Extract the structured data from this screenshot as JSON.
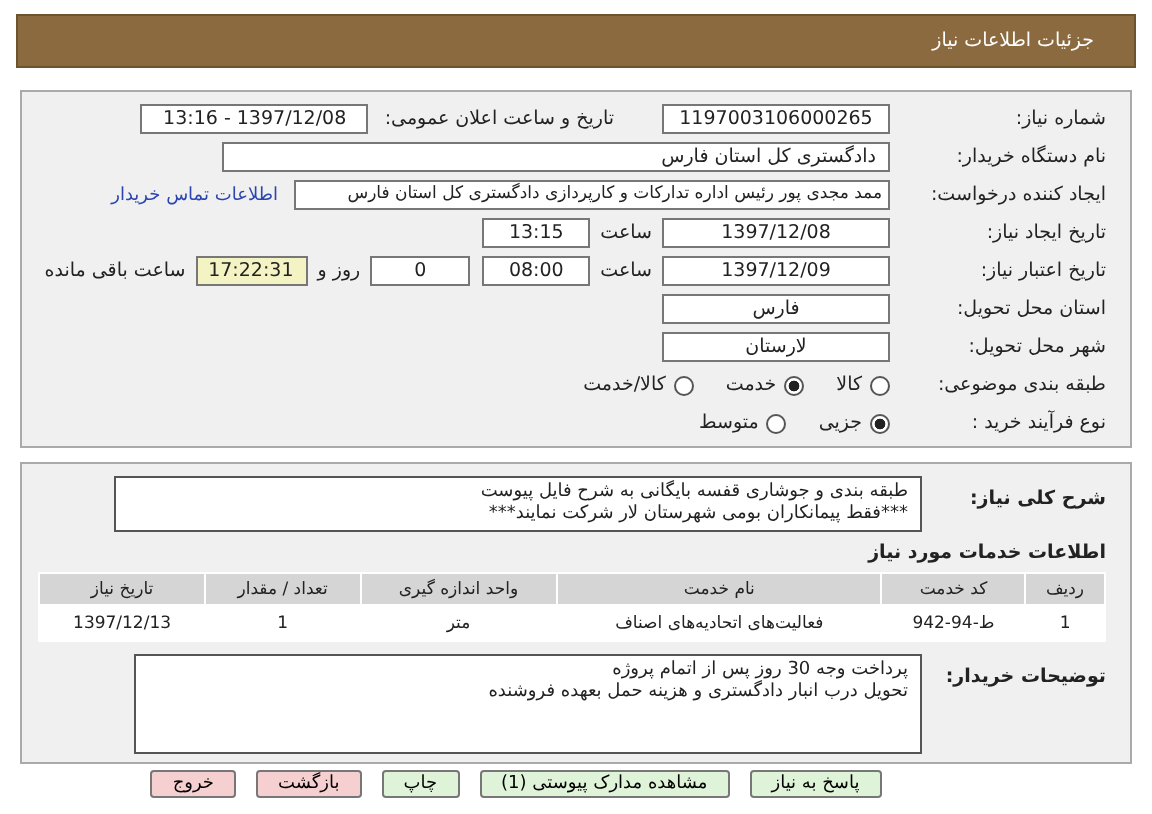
{
  "header": {
    "title": "جزئیات اطلاعات نیاز"
  },
  "form": {
    "need_number": {
      "label": "شماره نیاز:",
      "value": "1197003106000265"
    },
    "announce": {
      "label": "تاریخ و ساعت اعلان عمومی:",
      "value": "1397/12/08 - 13:16"
    },
    "buyer": {
      "label": "نام دستگاه خریدار:",
      "value": "دادگستری کل استان فارس"
    },
    "creator": {
      "label": "ایجاد کننده درخواست:",
      "value": "ممد مجدی پور رئیس اداره تدارکات و کارپردازی دادگستری کل استان فارس",
      "link": "اطلاعات تماس خریدار"
    },
    "created": {
      "label": "تاریخ ایجاد نیاز:",
      "date": "1397/12/08",
      "time_label": "ساعت",
      "time": "13:15"
    },
    "validity": {
      "label": "تاریخ اعتبار نیاز:",
      "date": "1397/12/09",
      "time_label": "ساعت",
      "time": "08:00",
      "days": "0",
      "days_label": "روز و",
      "remaining": "17:22:31",
      "remaining_label": "ساعت باقی مانده"
    },
    "province": {
      "label": "استان محل تحویل:",
      "value": "فارس"
    },
    "city": {
      "label": "شهر محل تحویل:",
      "value": "لارستان"
    },
    "category": {
      "label": "طبقه بندی موضوعی:",
      "options": [
        {
          "label": "کالا",
          "selected": false
        },
        {
          "label": "خدمت",
          "selected": true
        },
        {
          "label": "کالا/خدمت",
          "selected": false
        }
      ]
    },
    "process": {
      "label": "نوع فرآیند خرید :",
      "options": [
        {
          "label": "جزیی",
          "selected": true
        },
        {
          "label": "متوسط",
          "selected": false
        }
      ]
    }
  },
  "details": {
    "description_label": "شرح کلی نیاز:",
    "description_lines": [
      "طبقه بندی و جوشاری قفسه بایگانی به شرح فایل پیوست",
      "***فقط پیمانکاران بومی شهرستان لار شرکت نمایند***"
    ],
    "services_title": "اطلاعات خدمات مورد نیاز",
    "table": {
      "columns": [
        "ردیف",
        "کد خدمت",
        "نام خدمت",
        "واحد اندازه گیری",
        "تعداد / مقدار",
        "تاریخ نیاز"
      ],
      "rows": [
        [
          "1",
          "ط-94-942",
          "فعالیت‌های اتحادیه‌های اصناف",
          "متر",
          "1",
          "1397/12/13"
        ]
      ]
    },
    "notes_label": "توضیحات خریدار:",
    "notes_lines": [
      "پرداخت وجه 30 روز پس از اتمام پروژه",
      "تحویل درب انبار دادگستری و هزینه حمل بعهده فروشنده"
    ]
  },
  "buttons": [
    {
      "label": "پاسخ به نیاز",
      "kind": "green"
    },
    {
      "label": "مشاهده مدارک پیوستی (1)",
      "kind": "green"
    },
    {
      "label": "چاپ",
      "kind": "green"
    },
    {
      "label": "بازگشت",
      "kind": "red"
    },
    {
      "label": "خروج",
      "kind": "red"
    }
  ]
}
